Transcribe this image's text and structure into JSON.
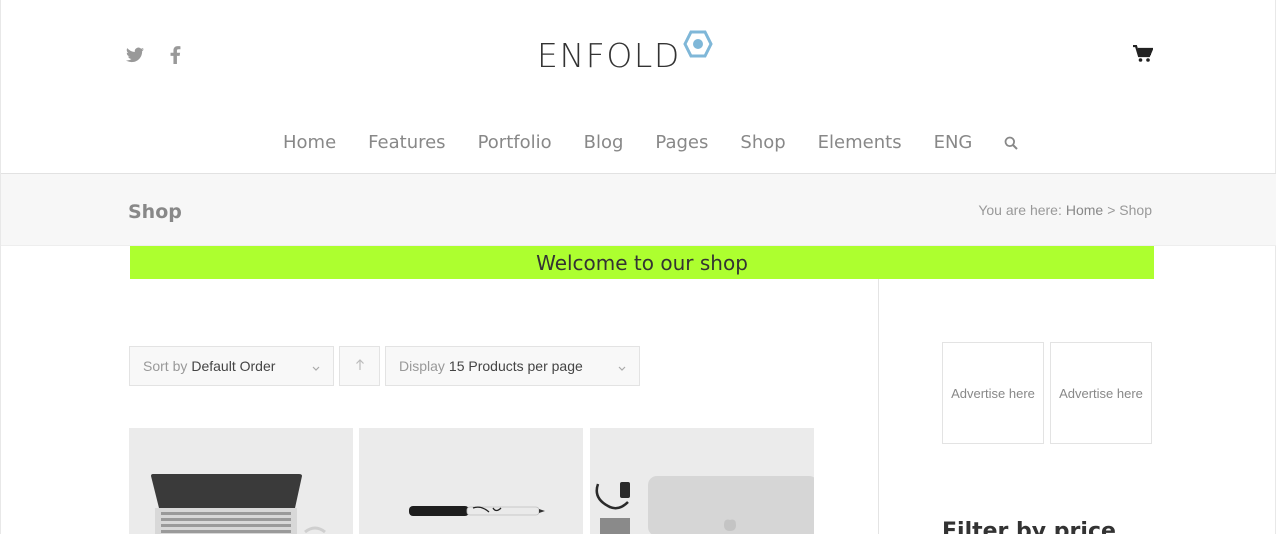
{
  "brand": {
    "logo_text": "ENFOLD",
    "accent": "#7fb7d8"
  },
  "social": {
    "icons": [
      "twitter-icon",
      "facebook-icon"
    ]
  },
  "nav": {
    "items": [
      "Home",
      "Features",
      "Portfolio",
      "Blog",
      "Pages",
      "Shop",
      "Elements",
      "ENG"
    ]
  },
  "title_bar": {
    "title": "Shop",
    "breadcrumb_prefix": "You are here:",
    "breadcrumb_home": "Home",
    "breadcrumb_current": "> Shop"
  },
  "banner": {
    "text": "Welcome to our shop",
    "color": "#adff2f"
  },
  "sorting": {
    "sort_key": "Sort by",
    "sort_value": "Default Order",
    "display_key": "Display",
    "display_value": "15 Products per page"
  },
  "sidebar": {
    "ads": [
      "Advertise here",
      "Advertise here"
    ],
    "filter_title": "Filter by price"
  }
}
